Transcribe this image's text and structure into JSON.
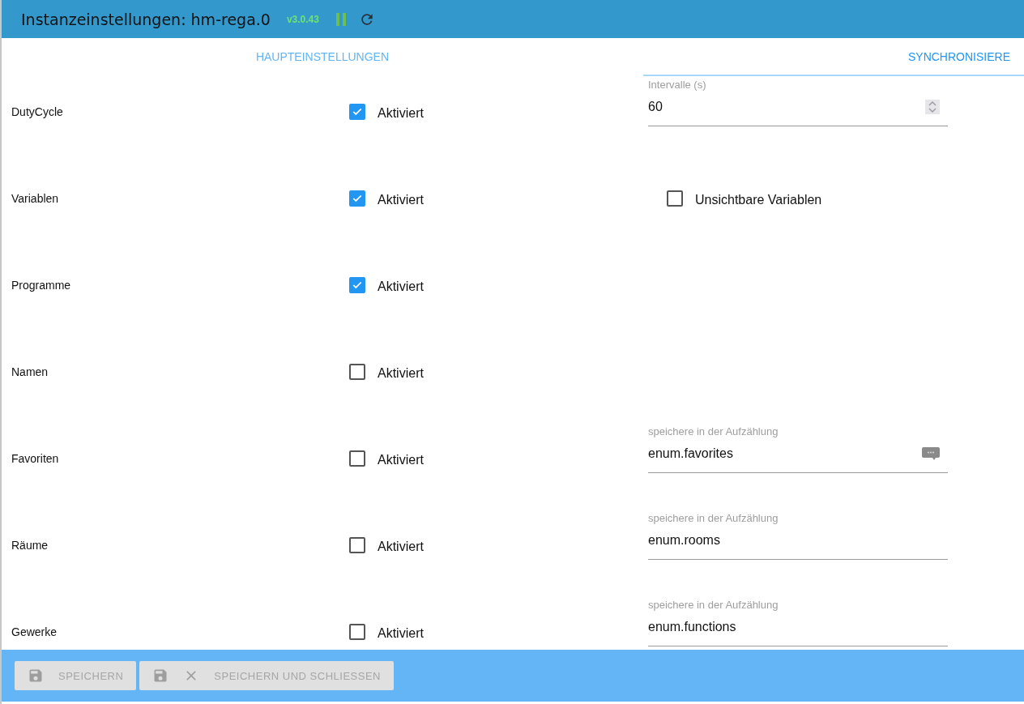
{
  "header": {
    "title": "Instanzeinstellungen: hm-rega.0",
    "version": "v3.0.43"
  },
  "tabs": [
    {
      "label": "HAUPTEINSTELLUNGEN",
      "selected": false
    },
    {
      "label": "SYNCHRONISIERE",
      "selected": true
    }
  ],
  "rows": [
    {
      "label": "DutyCycle",
      "checked": true,
      "check_label": "Aktiviert",
      "extra": {
        "kind": "number",
        "label": "Intervalle (s)",
        "value": "60"
      }
    },
    {
      "label": "Variablen",
      "checked": true,
      "check_label": "Aktiviert",
      "extra": {
        "kind": "checkbox",
        "label": "Unsichtbare Variablen",
        "checked": false
      }
    },
    {
      "label": "Programme",
      "checked": true,
      "check_label": "Aktiviert"
    },
    {
      "label": "Namen",
      "checked": false,
      "check_label": "Aktiviert"
    },
    {
      "label": "Favoriten",
      "checked": false,
      "check_label": "Aktiviert",
      "extra": {
        "kind": "text",
        "label": "speichere in der Aufzählung",
        "value": "enum.favorites",
        "icon": true
      }
    },
    {
      "label": "Räume",
      "checked": false,
      "check_label": "Aktiviert",
      "extra": {
        "kind": "text",
        "label": "speichere in der Aufzählung",
        "value": "enum.rooms"
      }
    },
    {
      "label": "Gewerke",
      "checked": false,
      "check_label": "Aktiviert",
      "extra": {
        "kind": "text",
        "label": "speichere in der Aufzählung",
        "value": "enum.functions"
      }
    }
  ],
  "footer": {
    "buttons": [
      {
        "label": "SPEICHERN",
        "disabled": true
      },
      {
        "label": "SPEICHERN UND SCHLIESSEN",
        "disabled": true,
        "close_icon": true
      }
    ]
  }
}
